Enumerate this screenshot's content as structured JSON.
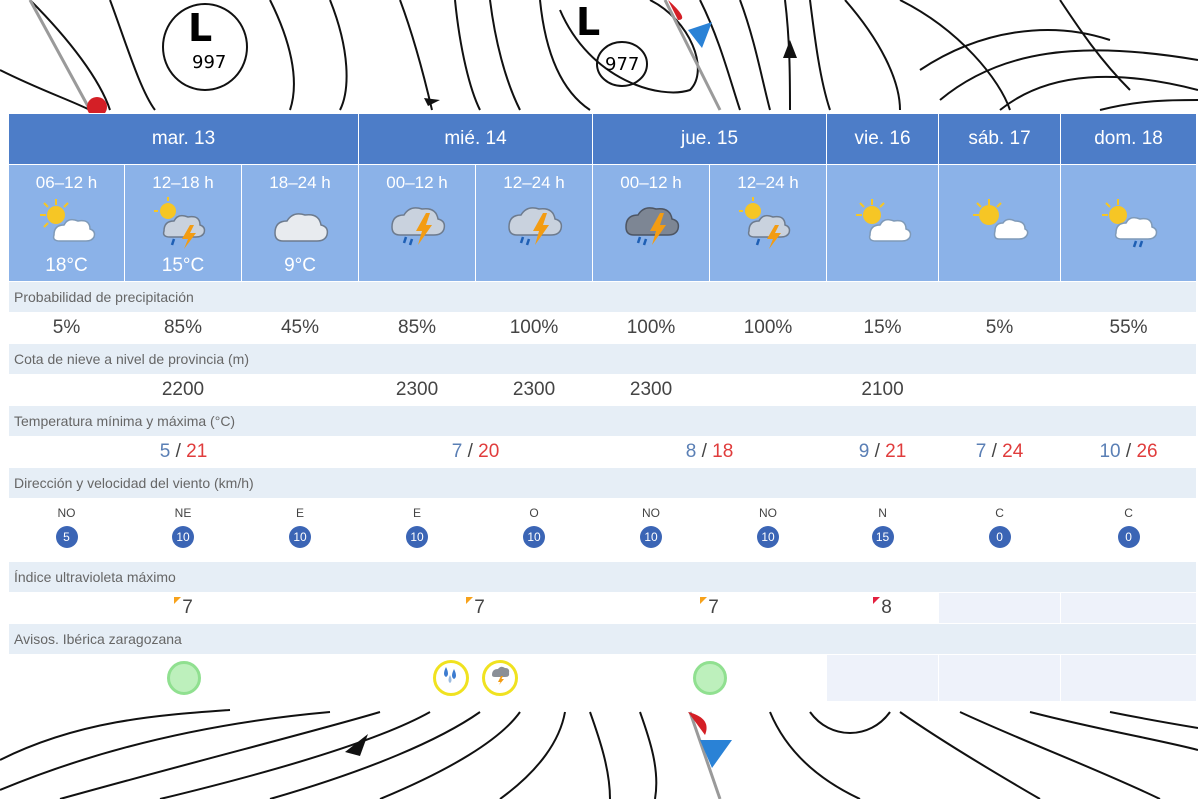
{
  "map": {
    "lows": [
      {
        "letter": "L",
        "pressure": "997"
      },
      {
        "letter": "L",
        "pressure": "977"
      }
    ]
  },
  "days": [
    {
      "label": "mar. 13",
      "span": 3
    },
    {
      "label": "mié. 14",
      "span": 2
    },
    {
      "label": "jue. 15",
      "span": 2
    },
    {
      "label": "vie. 16",
      "span": 1
    },
    {
      "label": "sáb. 17",
      "span": 1
    },
    {
      "label": "dom. 18",
      "span": 1
    }
  ],
  "periods": [
    {
      "label": "06–12 h",
      "icon": "sun-cloud-icon",
      "temp": "18°C"
    },
    {
      "label": "12–18 h",
      "icon": "storm-sun-icon",
      "temp": "15°C"
    },
    {
      "label": "18–24 h",
      "icon": "cloud-icon",
      "temp": "9°C"
    },
    {
      "label": "00–12 h",
      "icon": "storm-rain-icon",
      "temp": ""
    },
    {
      "label": "12–24 h",
      "icon": "storm-rain-icon",
      "temp": ""
    },
    {
      "label": "00–12 h",
      "icon": "storm-dark-icon",
      "temp": ""
    },
    {
      "label": "12–24 h",
      "icon": "storm-sun-icon",
      "temp": ""
    },
    {
      "label": "",
      "icon": "sun-cloud-icon",
      "temp": ""
    },
    {
      "label": "",
      "icon": "sun-cloud-icon",
      "temp": ""
    },
    {
      "label": "",
      "icon": "sun-rain-icon",
      "temp": ""
    }
  ],
  "sections": {
    "precip": "Probabilidad de precipitación",
    "snow": "Cota de nieve a nivel de provincia (m)",
    "temp": "Temperatura mínima y máxima (°C)",
    "wind": "Dirección y velocidad del viento (km/h)",
    "uv": "Índice ultravioleta máximo",
    "avisos": "Avisos. Ibérica zaragozana"
  },
  "precip": [
    "5%",
    "85%",
    "45%",
    "85%",
    "100%",
    "100%",
    "100%",
    "15%",
    "5%",
    "55%"
  ],
  "snow": [
    "",
    "2200",
    "",
    "2300",
    "2300",
    "2300",
    "",
    "2100",
    "",
    ""
  ],
  "minmax": [
    {
      "min": "5",
      "sep": " / ",
      "max": "21"
    },
    {
      "min": "7",
      "sep": " / ",
      "max": "20"
    },
    {
      "min": "8",
      "sep": " / ",
      "max": "18"
    },
    {
      "min": "9",
      "sep": " / ",
      "max": "21"
    },
    {
      "min": "7",
      "sep": " / ",
      "max": "24"
    },
    {
      "min": "10",
      "sep": " / ",
      "max": "26"
    }
  ],
  "wind": [
    {
      "dir": "NO",
      "speed": "5"
    },
    {
      "dir": "NE",
      "speed": "10"
    },
    {
      "dir": "E",
      "speed": "10"
    },
    {
      "dir": "E",
      "speed": "10"
    },
    {
      "dir": "O",
      "speed": "10"
    },
    {
      "dir": "NO",
      "speed": "10"
    },
    {
      "dir": "NO",
      "speed": "10"
    },
    {
      "dir": "N",
      "speed": "15"
    },
    {
      "dir": "C",
      "speed": "0"
    },
    {
      "dir": "C",
      "speed": "0"
    }
  ],
  "uv": [
    {
      "value": "7",
      "level": "orange"
    },
    {
      "value": "7",
      "level": "orange"
    },
    {
      "value": "7",
      "level": "orange"
    },
    {
      "value": "8",
      "level": "red"
    },
    {
      "value": "",
      "level": ""
    },
    {
      "value": "",
      "level": ""
    }
  ],
  "avisos": [
    {
      "type": "green"
    },
    {
      "type": "yellow",
      "icons": [
        "rain-icon",
        "storm-icon"
      ]
    },
    {
      "type": "green"
    },
    {
      "type": ""
    },
    {
      "type": ""
    },
    {
      "type": ""
    }
  ],
  "colors": {
    "header_bg": "#4d7dc8",
    "period_bg": "#8bb2e8",
    "section_bg": "#e6eef6",
    "max_temp": "#e03c3c",
    "wind_badge": "#3b65b5",
    "uv_orange": "#f7a21b",
    "uv_red": "#e3203f",
    "aviso_green": "#bdf0bc",
    "aviso_yellow": "#f0e220"
  }
}
